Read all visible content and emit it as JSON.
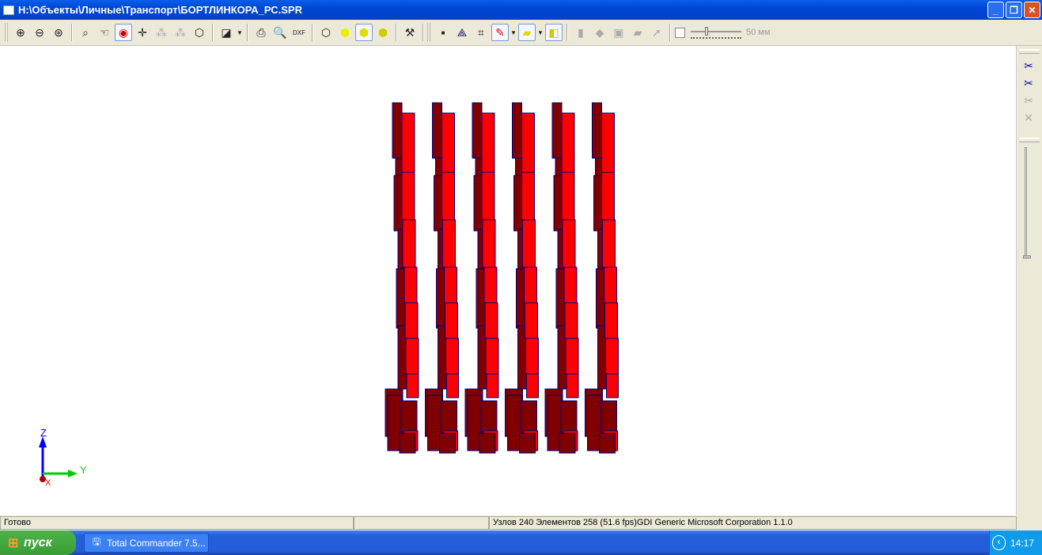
{
  "window": {
    "title": "H:\\Объекты\\Личные\\Транспорт\\БОРТЛИНКОРА_РС.SPR"
  },
  "toolbar": {
    "slider_value_label": "50 мм"
  },
  "viewport": {
    "axes": {
      "z": "Z",
      "y": "Y",
      "x": "X"
    },
    "colors": {
      "member": "#ff0000",
      "member_dark": "#800000",
      "edge": "#000080"
    }
  },
  "statusbar": {
    "status": "Готово",
    "panel2": "",
    "info": "Узлов 240  Элементов 258  (51.6 fps)GDI Generic Microsoft Corporation 1.1.0"
  },
  "taskbar": {
    "start_label": "пуск",
    "task": "Total Commander 7.5...",
    "clock": "14:17"
  }
}
